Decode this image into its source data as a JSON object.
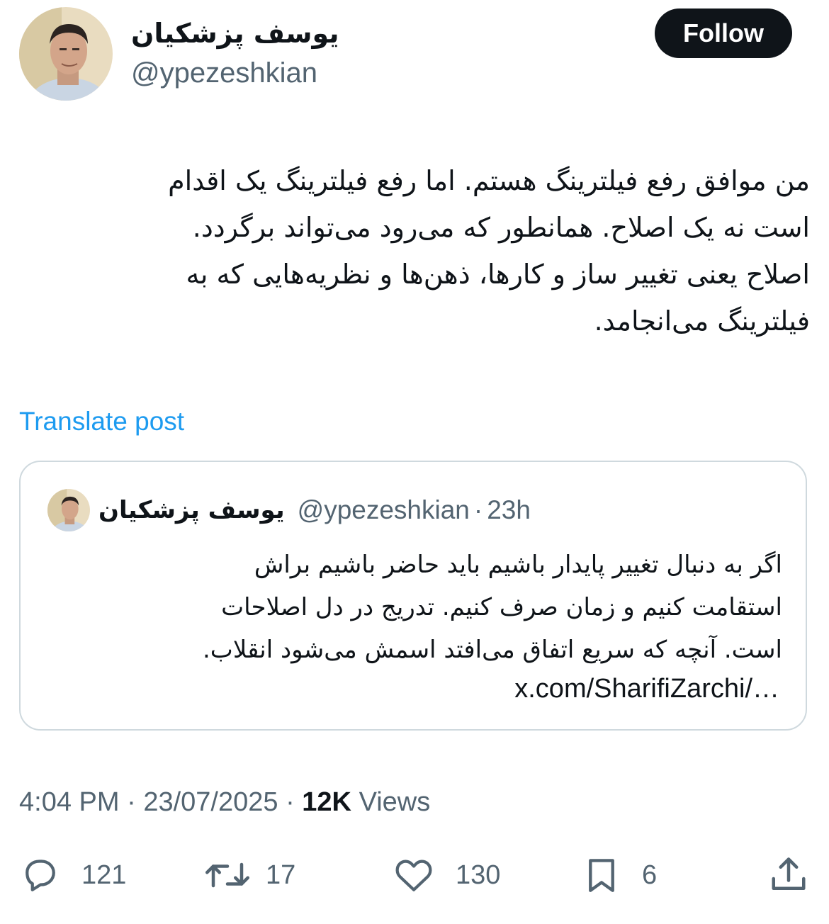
{
  "author": {
    "display_name": "یوسف پزشکیان",
    "handle": "@ypezeshkian"
  },
  "follow_button": {
    "label": "Follow"
  },
  "tweet": {
    "lines": [
      "من موافق رفع فیلترینگ هستم. اما رفع فیلترینگ یک اقدام",
      "است نه یک اصلاح. همانطور که می‌رود می‌تواند برگردد.",
      "اصلاح یعنی تغییر ساز و کارها، ذهن‌ها و نظریه‌هایی که به",
      "فیلترینگ می‌انجامد."
    ]
  },
  "translate_link": "Translate post",
  "quoted_tweet": {
    "display_name": "یوسف پزشکیان",
    "handle": "@ypezeshkian",
    "separator": "·",
    "time": "23h",
    "lines": [
      "اگر به دنبال تغییر پایدار باشیم باید حاضر باشیم براش",
      "استقامت کنیم و زمان صرف کنیم. تدریج در دل اصلاحات",
      "است. آنچه که سریع اتفاق می‌افتد اسمش می‌شود انقلاب."
    ],
    "link": "x.com/SharifiZarchi/…"
  },
  "meta": {
    "time": "4:04 PM",
    "separator": "·",
    "date": "23/07/2025",
    "views_count": "12K",
    "views_label": "Views"
  },
  "actions": {
    "reply_count": "121",
    "repost_count": "17",
    "like_count": "130",
    "bookmark_count": "6"
  },
  "colors": {
    "text": "#0f1419",
    "secondary": "#536471",
    "link": "#1d9bf0",
    "border": "#cfd9de",
    "button": "#0f1419"
  }
}
